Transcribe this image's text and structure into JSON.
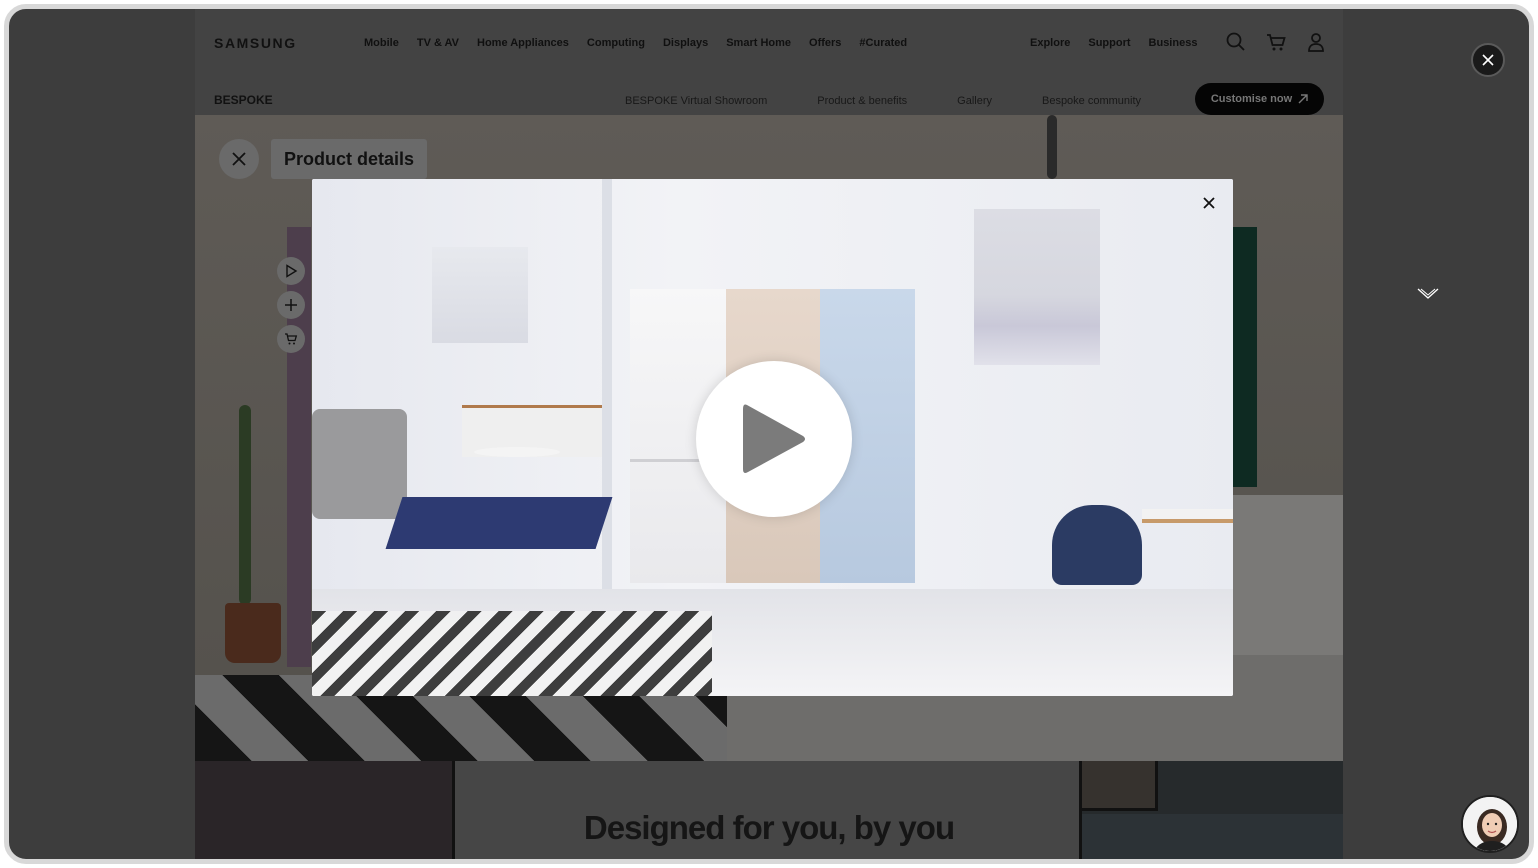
{
  "header": {
    "logo": "SAMSUNG",
    "nav": [
      "Mobile",
      "TV & AV",
      "Home Appliances",
      "Computing",
      "Displays",
      "Smart Home",
      "Offers",
      "#Curated"
    ],
    "utility": [
      "Explore",
      "Support",
      "Business"
    ],
    "icons": [
      "search-icon",
      "cart-icon",
      "user-icon"
    ]
  },
  "subnav": {
    "title": "BESPOKE",
    "links": [
      "BESPOKE Virtual Showroom",
      "Product & benefits",
      "Gallery",
      "Bespoke community"
    ],
    "cta": "Customise now"
  },
  "showroom": {
    "product_details_label": "Product details",
    "side_icons": [
      "play-icon",
      "plus-icon",
      "cart-icon"
    ]
  },
  "section": {
    "headline": "Designed for you, by you"
  },
  "modal": {
    "type": "video",
    "controls": [
      "close-icon",
      "play-icon"
    ]
  },
  "colors": {
    "overlay": "#3d3d3d",
    "cta_bg": "#050505",
    "fridge_white": "#f4f4f6",
    "fridge_beige": "#e2d2c5",
    "fridge_blue": "#c2d3e7",
    "chair_navy": "#2b3b63"
  }
}
